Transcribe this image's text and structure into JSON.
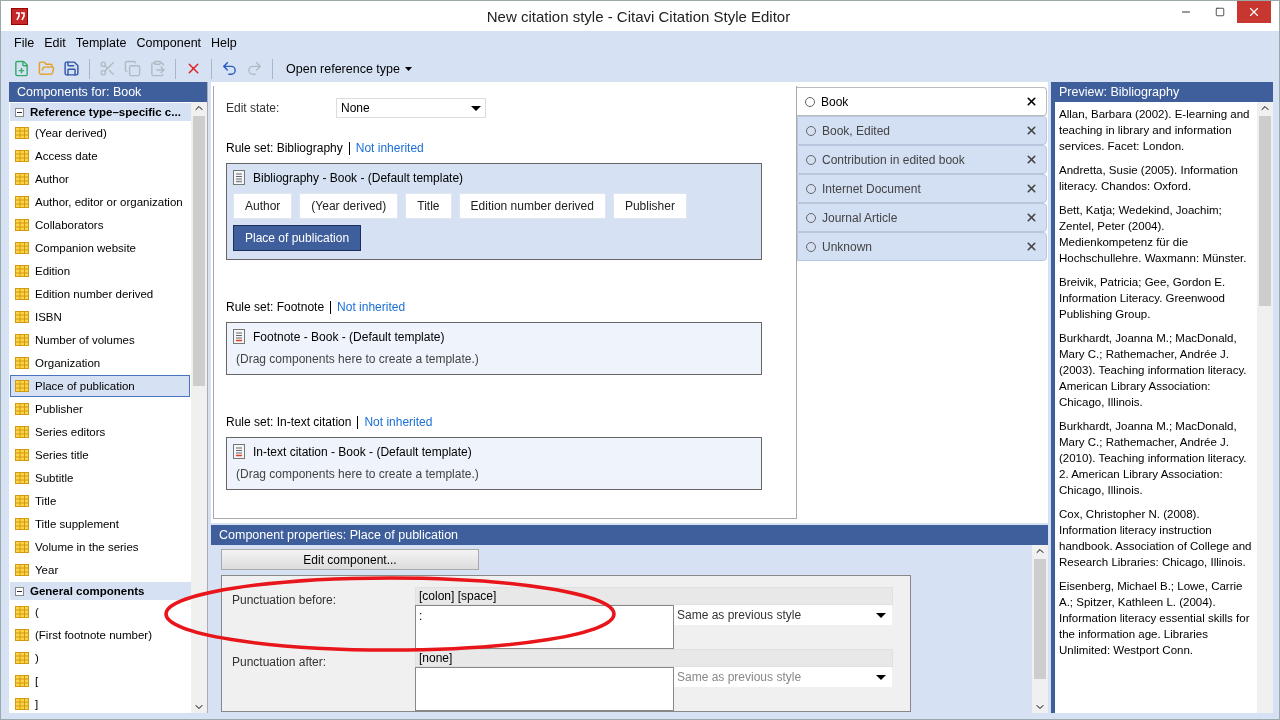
{
  "window": {
    "title": "New citation style - Citavi Citation Style Editor"
  },
  "menu": [
    "File",
    "Edit",
    "Template",
    "Component",
    "Help"
  ],
  "toolbar": [
    {
      "kind": "new",
      "disabled": false
    },
    {
      "kind": "open",
      "disabled": false
    },
    {
      "kind": "save",
      "disabled": false
    },
    {
      "kind": "sep"
    },
    {
      "kind": "cut",
      "disabled": true
    },
    {
      "kind": "copy",
      "disabled": true
    },
    {
      "kind": "paste",
      "disabled": true
    },
    {
      "kind": "sep"
    },
    {
      "kind": "delete",
      "disabled": false
    },
    {
      "kind": "sep"
    },
    {
      "kind": "undo",
      "disabled": false
    },
    {
      "kind": "redo",
      "disabled": true
    },
    {
      "kind": "sep"
    },
    {
      "kind": "dropdown",
      "label": "Open reference type"
    }
  ],
  "sidebar": {
    "title": "Components for: Book",
    "groups": [
      {
        "label": "Reference type–specific c...",
        "expanded": true,
        "items": [
          {
            "label": "(Year derived)",
            "selected": false
          },
          {
            "label": "Access date",
            "selected": false
          },
          {
            "label": "Author",
            "selected": false
          },
          {
            "label": "Author, editor or organization",
            "selected": false
          },
          {
            "label": "Collaborators",
            "selected": false
          },
          {
            "label": "Companion website",
            "selected": false
          },
          {
            "label": "Edition",
            "selected": false
          },
          {
            "label": "Edition number derived",
            "selected": false
          },
          {
            "label": "ISBN",
            "selected": false
          },
          {
            "label": "Number of volumes",
            "selected": false
          },
          {
            "label": "Organization",
            "selected": false
          },
          {
            "label": "Place of publication",
            "selected": true
          },
          {
            "label": "Publisher",
            "selected": false
          },
          {
            "label": "Series editors",
            "selected": false
          },
          {
            "label": "Series title",
            "selected": false
          },
          {
            "label": "Subtitle",
            "selected": false
          },
          {
            "label": "Title",
            "selected": false
          },
          {
            "label": "Title supplement",
            "selected": false
          },
          {
            "label": "Volume in the series",
            "selected": false
          },
          {
            "label": "Year",
            "selected": false
          }
        ]
      },
      {
        "label": "General components",
        "expanded": true,
        "items": [
          {
            "label": "(",
            "selected": false
          },
          {
            "label": "(First footnote number)",
            "selected": false
          },
          {
            "label": ")",
            "selected": false
          },
          {
            "label": "[",
            "selected": false
          },
          {
            "label": "]",
            "selected": false
          }
        ]
      }
    ]
  },
  "editor": {
    "edit_state_label": "Edit state:",
    "edit_state": "None",
    "rule_sets": [
      {
        "title": "Rule set: Bibliography",
        "link": "Not inherited",
        "template": "Bibliography - Book - (Default template)",
        "kind": "bibliography",
        "components": [
          {
            "label": "Author",
            "selected": false
          },
          {
            "label": "(Year derived)",
            "selected": false
          },
          {
            "label": "Title",
            "selected": false
          },
          {
            "label": "Edition number derived",
            "selected": false
          },
          {
            "label": "Publisher",
            "selected": false
          },
          {
            "label": "Place of publication",
            "selected": true
          }
        ]
      },
      {
        "title": "Rule set: Footnote",
        "link": "Not inherited",
        "template": "Footnote - Book - (Default template)",
        "kind": "footnote",
        "hint": "(Drag components here to create a template.)"
      },
      {
        "title": "Rule set: In-text citation",
        "link": "Not inherited",
        "template": "In-text citation - Book - (Default template)",
        "kind": "citation",
        "hint": "(Drag components here to create a template.)"
      }
    ]
  },
  "reference_types": [
    {
      "label": "Book",
      "selected": true
    },
    {
      "label": "Book, Edited",
      "selected": false
    },
    {
      "label": "Contribution in edited book",
      "selected": false
    },
    {
      "label": "Internet Document",
      "selected": false
    },
    {
      "label": "Journal Article",
      "selected": false
    },
    {
      "label": "Unknown",
      "selected": false
    }
  ],
  "properties": {
    "title": "Component properties:  Place of publication",
    "button": "Edit component...",
    "rows": [
      {
        "label": "Punctuation before:",
        "summary": "[colon] [space]",
        "value": ":",
        "style": "Same as previous style",
        "disabled": false
      },
      {
        "label": "Punctuation after:",
        "summary": "[none]",
        "value": "",
        "style": "Same as previous style",
        "disabled": true
      }
    ]
  },
  "preview": {
    "title": "Preview: Bibliography",
    "entries": [
      "Allan, Barbara (2002). E-learning and teaching in library and information services. Facet: London.",
      "Andretta, Susie (2005). Information literacy. Chandos: Oxford.",
      "Bett, Katja; Wedekind, Joachim; Zentel, Peter (2004). Medienkompetenz für die Hochschullehre. Waxmann: Münster.",
      "Breivik, Patricia; Gee, Gordon E. Information Literacy. Greenwood Publishing Group.",
      "Burkhardt, Joanna M.; MacDonald, Mary C.; Rathemacher, Andrée J. (2003). Teaching information literacy. American Library Association: Chicago, Illinois.",
      "Burkhardt, Joanna M.; MacDonald, Mary C.; Rathemacher, Andrée J. (2010). Teaching information literacy. 2. American Library Association: Chicago, Illinois.",
      "Cox, Christopher N. (2008). Information literacy instruction handbook. Association of College and Research Libraries: Chicago, Illinois.",
      "Eisenberg, Michael B.; Lowe, Carrie A.; Spitzer, Kathleen L. (2004). Information literacy essential skills for the information age. Libraries Unlimited: Westport Conn."
    ]
  },
  "annotation": {
    "kind": "ellipse",
    "color": "#e8151b"
  }
}
